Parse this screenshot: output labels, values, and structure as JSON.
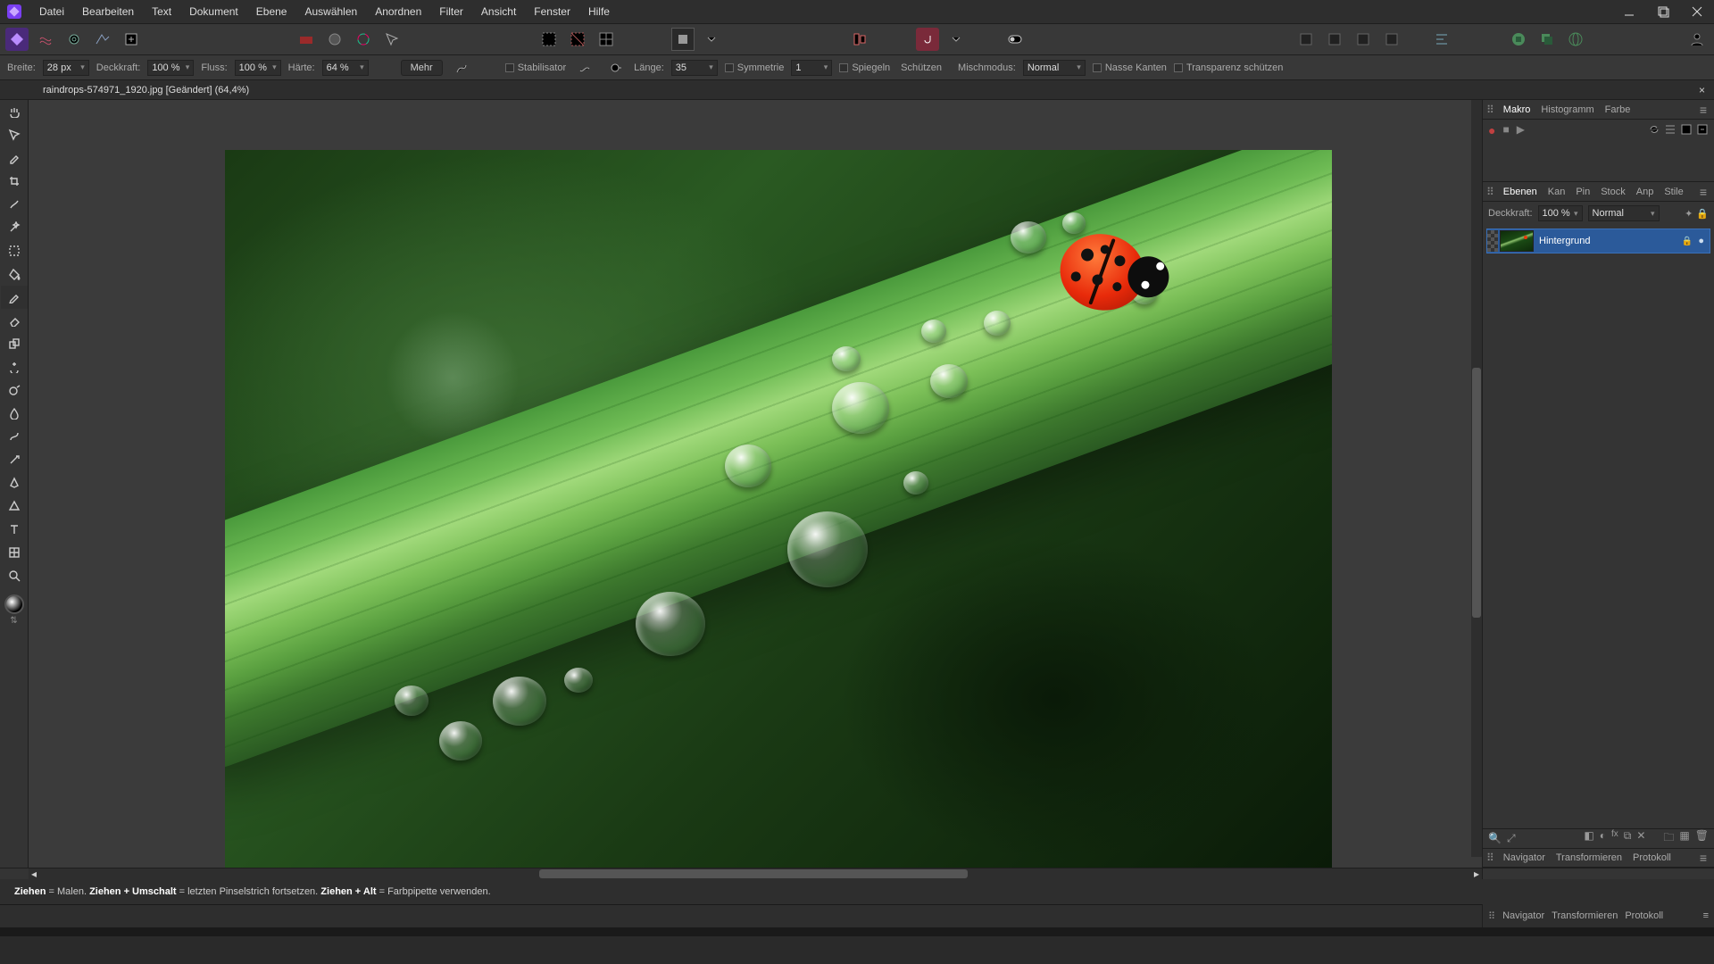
{
  "menu": {
    "items": [
      "Datei",
      "Bearbeiten",
      "Text",
      "Dokument",
      "Ebene",
      "Auswählen",
      "Anordnen",
      "Filter",
      "Ansicht",
      "Fenster",
      "Hilfe"
    ]
  },
  "document": {
    "tab_title": "raindrops-574971_1920.jpg [Geändert] (64,4%)"
  },
  "context": {
    "width_label": "Breite:",
    "width_value": "28 px",
    "opacity_label": "Deckkraft:",
    "opacity_value": "100 %",
    "flow_label": "Fluss:",
    "flow_value": "100 %",
    "hardness_label": "Härte:",
    "hardness_value": "64 %",
    "more": "Mehr",
    "stabilizer": "Stabilisator",
    "length_label": "Länge:",
    "length_value": "35",
    "symmetry": "Symmetrie",
    "symmetry_value": "1",
    "mirror": "Spiegeln",
    "protect": "Schützen",
    "blend_label": "Mischmodus:",
    "blend_value": "Normal",
    "wet_edges": "Nasse Kanten",
    "protect_alpha": "Transparenz schützen"
  },
  "right": {
    "tabs1": [
      "Makro",
      "Histogramm",
      "Farbe"
    ],
    "tabs2": [
      "Ebenen",
      "Kan",
      "Pin",
      "Stock",
      "Anp",
      "Stile"
    ],
    "tabs3": [
      "Navigator",
      "Transformieren",
      "Protokoll"
    ],
    "layer_opacity_label": "Deckkraft:",
    "layer_opacity_value": "100 %",
    "layer_blend": "Normal",
    "layer_name": "Hintergrund"
  },
  "status": {
    "s1a": "Ziehen",
    "s1b": " = Malen. ",
    "s2a": "Ziehen + Umschalt",
    "s2b": " = letzten Pinselstrich fortsetzen. ",
    "s3a": "Ziehen + Alt",
    "s3b": " = Farbpipette verwenden."
  }
}
